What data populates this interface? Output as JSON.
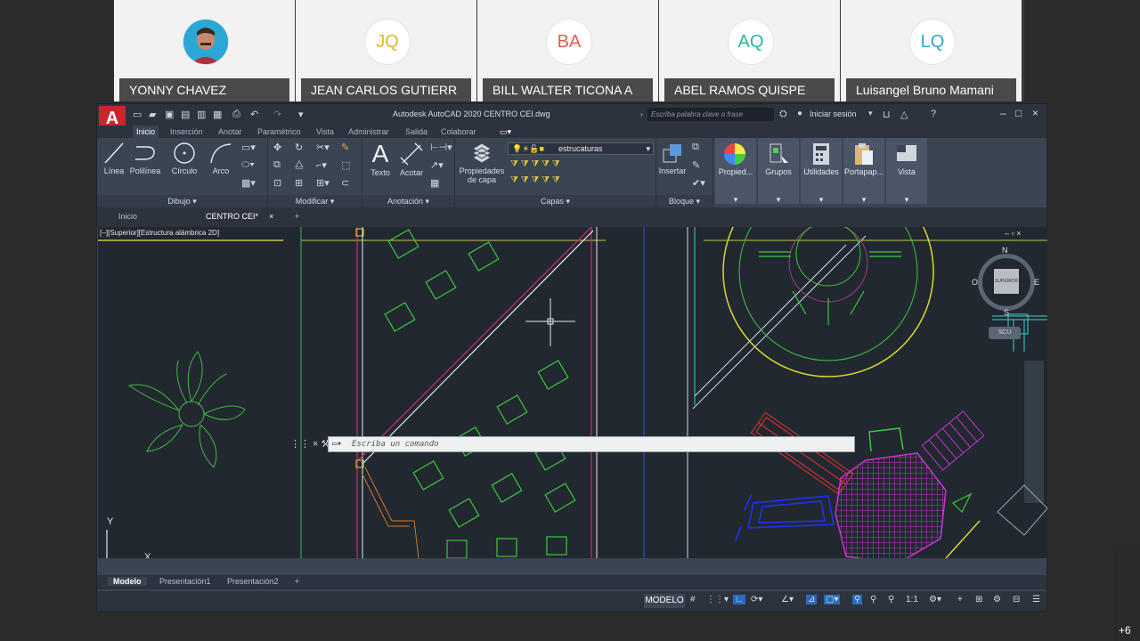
{
  "participants": [
    {
      "name": "YONNY CHAVEZ",
      "initials": "",
      "color": "#28a8d8"
    },
    {
      "name": "JEAN CARLOS GUTIERR",
      "initials": "JQ",
      "color": "#e8b430"
    },
    {
      "name": "BILL WALTER TICONA A",
      "initials": "BA",
      "color": "#e45c4c"
    },
    {
      "name": "ABEL RAMOS QUISPE",
      "initials": "AQ",
      "color": "#2bb4a0"
    },
    {
      "name": "Luisangel Bruno Mamani",
      "initials": "LQ",
      "color": "#2ea5d3"
    }
  ],
  "more_participants": "+6",
  "window": {
    "logo": "A",
    "title": "Autodesk AutoCAD 2020   CENTRO CEI.dwg",
    "search_placeholder": "Escriba palabra clave o frase",
    "sign_in": "Iniciar sesión"
  },
  "ribbon_tabs": [
    "Inicio",
    "Inserción",
    "Anotar",
    "Paramétrico",
    "Vista",
    "Administrar",
    "Salida",
    "Colaborar"
  ],
  "ribbon": {
    "draw": {
      "title": "Dibujo",
      "line": "Línea",
      "polyline": "Polilínea",
      "circle": "Círculo",
      "arc": "Arco"
    },
    "modify": {
      "title": "Modificar"
    },
    "annotation": {
      "title": "Anotación",
      "text": "Texto",
      "dimension": "Acotar"
    },
    "layers": {
      "title": "Capas",
      "props_line1": "Propiedades",
      "props_line2": "de capa",
      "current_layer": "estrucaturas"
    },
    "block": {
      "title": "Bloque",
      "insert": "Insertar"
    },
    "big": {
      "properties": "Propied...",
      "groups": "Grupos",
      "utilities": "Utilidades",
      "clipboard": "Portapap...",
      "view": "Vista"
    }
  },
  "file_tabs": {
    "start": "Inicio",
    "current": "CENTRO CEI*"
  },
  "viewport": {
    "label": "[−][Superior][Estructura alámbrica 2D]",
    "compass": {
      "n": "N",
      "s": "S",
      "e": "E",
      "o": "O",
      "face": "SUPERIOR",
      "ucs": "SCU"
    },
    "ucs_y": "Y",
    "ucs_x": "X"
  },
  "command": {
    "placeholder": "Escriba un comando"
  },
  "layout_tabs": [
    "Modelo",
    "Presentación1",
    "Presentación2"
  ],
  "status": {
    "model": "MODELO",
    "scale": "1:1"
  },
  "colors": {
    "magenta": "#cc33cc",
    "green": "#33cc33",
    "yellow": "#e6e630",
    "cyan": "#33cccc",
    "blue": "#2020ff",
    "red": "#c83030"
  }
}
